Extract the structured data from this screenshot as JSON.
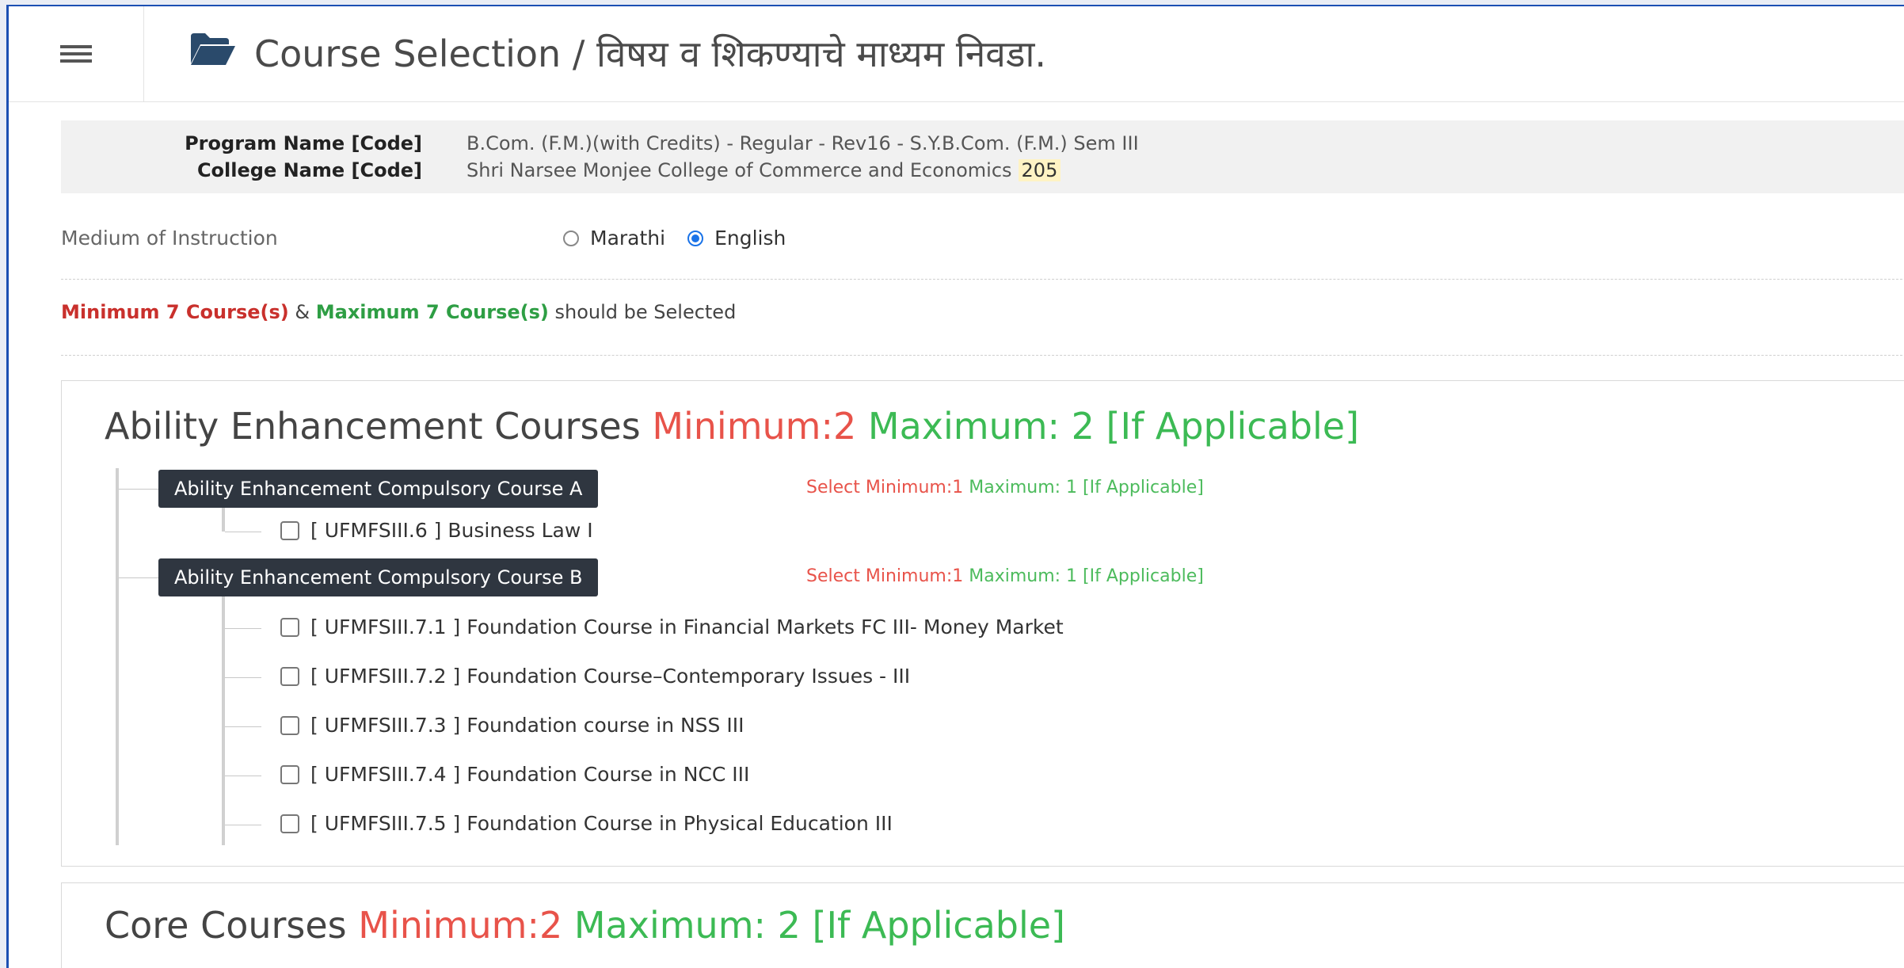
{
  "header": {
    "title": "Course Selection / विषय व शिकण्याचे माध्यम निवडा."
  },
  "program": {
    "program_label": "Program Name [Code]",
    "program_value": "B.Com. (F.M.)(with Credits) - Regular - Rev16 - S.Y.B.Com. (F.M.) Sem III",
    "college_label": "College Name [Code]",
    "college_value": "Shri Narsee Monjee College of Commerce and Economics",
    "college_code": "205"
  },
  "medium": {
    "label": "Medium of Instruction",
    "options": [
      "Marathi",
      "English"
    ],
    "selected": "English"
  },
  "selection_rule": {
    "min_text": "Minimum 7 Course(s)",
    "amp": "&",
    "max_text": "Maximum 7 Course(s)",
    "suffix": "should be Selected"
  },
  "panels": [
    {
      "title": "Ability Enhancement Courses",
      "min": "Minimum:2",
      "max": "Maximum: 2 [If Applicable]",
      "groups": [
        {
          "label": "Ability Enhancement Compulsory Course A",
          "hint_min": "Select Minimum:1",
          "hint_max": "Maximum: 1 [If Applicable]",
          "courses": [
            "[ UFMFSIII.6 ]  Business Law I"
          ]
        },
        {
          "label": "Ability Enhancement Compulsory Course B",
          "hint_min": "Select Minimum:1",
          "hint_max": "Maximum: 1 [If Applicable]",
          "courses": [
            "[ UFMFSIII.7.1 ]  Foundation Course in Financial Markets FC III- Money Market",
            "[ UFMFSIII.7.2 ]  Foundation Course–Contemporary Issues - III",
            "[ UFMFSIII.7.3 ]  Foundation course in NSS III",
            "[ UFMFSIII.7.4 ]  Foundation Course in NCC III",
            "[ UFMFSIII.7.5 ]  Foundation Course in Physical Education III"
          ]
        }
      ]
    },
    {
      "title": "Core Courses",
      "min": "Minimum:2",
      "max": "Maximum: 2 [If Applicable]"
    }
  ],
  "colors": {
    "accent": "#1a73e8",
    "min_red": "#e8534a",
    "max_green": "#3cba54",
    "group_bg": "#2f3640"
  },
  "icons": [
    "hamburger-icon",
    "folder-open-icon"
  ]
}
